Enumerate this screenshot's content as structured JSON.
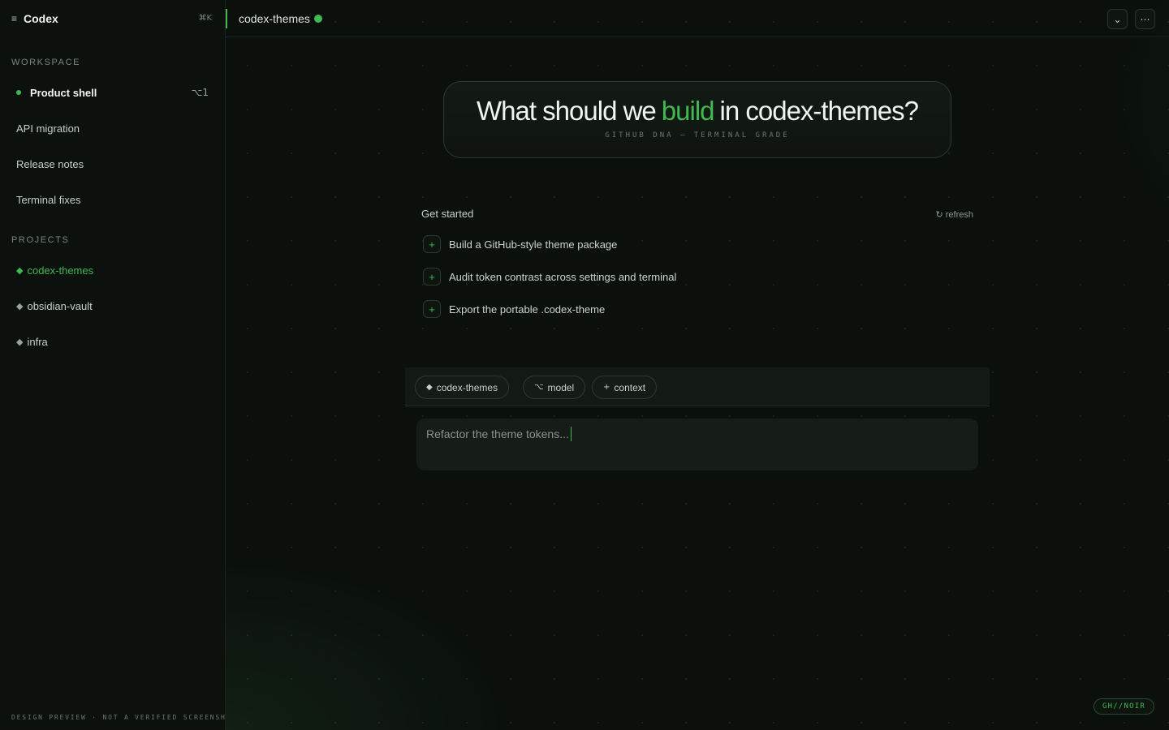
{
  "sidebar": {
    "menu_icon": "≡",
    "title": "Codex",
    "shortcut": "⌘K",
    "workspace_label": "WORKSPACE",
    "workspace_items": [
      {
        "label": "Product shell",
        "kbd": "⌥1",
        "active": true
      },
      {
        "label": "API migration"
      },
      {
        "label": "Release notes"
      },
      {
        "label": "Terminal fixes"
      }
    ],
    "projects_label": "PROJECTS",
    "project_diamond": "◆",
    "projects": [
      {
        "label": "codex-themes",
        "active": true
      },
      {
        "label": "obsidian-vault"
      },
      {
        "label": "infra"
      }
    ],
    "footer": "DESIGN PREVIEW · NOT A VERIFIED SCREENSHOT"
  },
  "topbar": {
    "tab_name": "codex-themes",
    "chevron_icon": "⌄",
    "more_icon": "⋯"
  },
  "hero": {
    "title_before": "What should we",
    "title_highlight": "build",
    "title_after": "in codex-themes?",
    "subtitle": "GITHUB DNA — TERMINAL GRADE"
  },
  "get_started": {
    "label": "Get started",
    "refresh": "↻ refresh",
    "plus": "+",
    "items": [
      "Build a GitHub-style theme package",
      "Audit token contrast across settings and terminal",
      "Export the portable .codex-theme"
    ]
  },
  "composer": {
    "chips": [
      {
        "icon": "◆",
        "label": "codex-themes"
      },
      {
        "icon": "⌥",
        "label": "model"
      },
      {
        "icon": "+",
        "label": "context"
      }
    ],
    "placeholder": "Refactor the theme tokens..."
  },
  "badge": "GH//NOIR",
  "colors": {
    "accent": "#3fb950",
    "background": "#0b0f0c"
  }
}
